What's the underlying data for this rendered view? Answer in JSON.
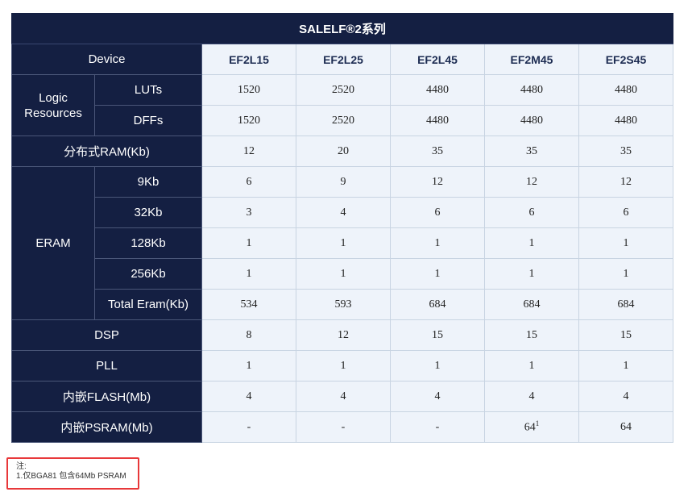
{
  "title": "SALELF®2系列",
  "device_label": "Device",
  "devices": [
    "EF2L15",
    "EF2L25",
    "EF2L45",
    "EF2M45",
    "EF2S45"
  ],
  "groups": {
    "logic": "Logic Resources",
    "eram": "ERAM"
  },
  "rows": {
    "luts": {
      "label": "LUTs",
      "values": [
        "1520",
        "2520",
        "4480",
        "4480",
        "4480"
      ]
    },
    "dffs": {
      "label": "DFFs",
      "values": [
        "1520",
        "2520",
        "4480",
        "4480",
        "4480"
      ]
    },
    "dram": {
      "label": "分布式RAM(Kb)",
      "values": [
        "12",
        "20",
        "35",
        "35",
        "35"
      ]
    },
    "kb9": {
      "label": "9Kb",
      "values": [
        "6",
        "9",
        "12",
        "12",
        "12"
      ]
    },
    "kb32": {
      "label": "32Kb",
      "values": [
        "3",
        "4",
        "6",
        "6",
        "6"
      ]
    },
    "kb128": {
      "label": "128Kb",
      "values": [
        "1",
        "1",
        "1",
        "1",
        "1"
      ]
    },
    "kb256": {
      "label": "256Kb",
      "values": [
        "1",
        "1",
        "1",
        "1",
        "1"
      ]
    },
    "total": {
      "label": "Total Eram(Kb)",
      "values": [
        "534",
        "593",
        "684",
        "684",
        "684"
      ]
    },
    "dsp": {
      "label": "DSP",
      "values": [
        "8",
        "12",
        "15",
        "15",
        "15"
      ]
    },
    "pll": {
      "label": "PLL",
      "values": [
        "1",
        "1",
        "1",
        "1",
        "1"
      ]
    },
    "flash": {
      "label": "内嵌FLASH(Mb)",
      "values": [
        "4",
        "4",
        "4",
        "4",
        "4"
      ]
    },
    "psram": {
      "label": "内嵌PSRAM(Mb)",
      "values": [
        "-",
        "-",
        "-",
        "64",
        "64"
      ],
      "footnote_mark": "1"
    }
  },
  "note": {
    "heading": "注:",
    "text": "1.仅BGA81 包含64Mb PSRAM"
  }
}
